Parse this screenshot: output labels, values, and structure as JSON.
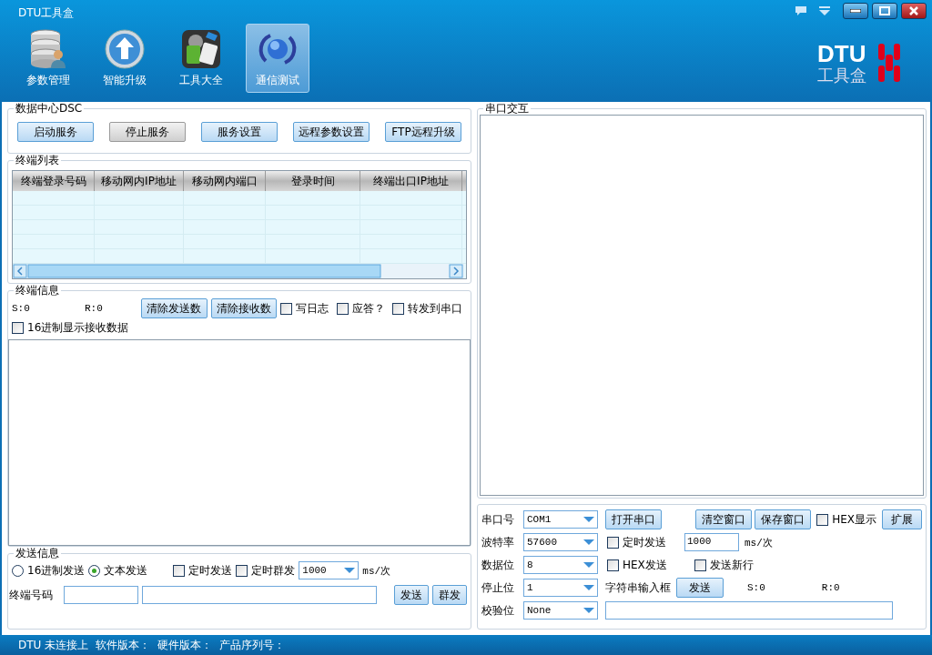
{
  "window": {
    "title": "DTU工具盒"
  },
  "toolbar": [
    {
      "label": "参数管理",
      "kind": "database",
      "selected": false
    },
    {
      "label": "智能升级",
      "kind": "upgrade",
      "selected": false
    },
    {
      "label": "工具大全",
      "kind": "tools",
      "selected": false
    },
    {
      "label": "通信测试",
      "kind": "globe",
      "selected": true
    }
  ],
  "logo": {
    "line_1": "DTU",
    "line_2": "工具盒"
  },
  "data_center": {
    "title": "数据中心DSC",
    "buttons": [
      "启动服务",
      "停止服务",
      "服务设置",
      "远程参数设置",
      "FTP远程升级"
    ]
  },
  "terminal_list": {
    "title": "终端列表",
    "columns": [
      "终端登录号码",
      "移动网内IP地址",
      "移动网内端口",
      "登录时间",
      "终端出口IP地址"
    ]
  },
  "terminal_info": {
    "title": "终端信息",
    "sent": "S:0",
    "received": "R:0",
    "buttons": [
      "清除发送数",
      "清除接收数"
    ],
    "options": [
      {
        "label": "写日志",
        "checked": false
      },
      {
        "label": "应答？",
        "checked": false
      },
      {
        "label": "转发到串口",
        "checked": false
      }
    ],
    "hex_receive": {
      "label": "16进制显示接收数据",
      "checked": false
    }
  },
  "send_info": {
    "title": "发送信息",
    "modes": [
      {
        "label": "16进制发送",
        "selected": false
      },
      {
        "label": "文本发送",
        "selected": true
      }
    ],
    "options": [
      {
        "label": "定时发送",
        "checked": false
      },
      {
        "label": "定时群发",
        "checked": false
      }
    ],
    "interval": "1000",
    "interval_unit": "ms/次",
    "terminal_label": "终端号码",
    "buttons": [
      "发送",
      "群发"
    ]
  },
  "serial": {
    "title": "串口交互",
    "fields": [
      {
        "label": "串口号",
        "value": "COM1"
      },
      {
        "label": "波特率",
        "value": "57600"
      },
      {
        "label": "数据位",
        "value": "8"
      },
      {
        "label": "停止位",
        "value": "1"
      },
      {
        "label": "校验位",
        "value": "None"
      }
    ],
    "open_button": "打开串口",
    "clear_button": "清空窗口",
    "save_button": "保存窗口",
    "hex_display": {
      "label": "HEX显示",
      "checked": false
    },
    "expand_button": "扩展",
    "timed_send": {
      "label": "定时发送",
      "checked": false
    },
    "interval": "1000",
    "interval_unit": "ms/次",
    "hex_send": {
      "label": "HEX发送",
      "checked": false
    },
    "send_newline": {
      "label": "发送新行",
      "checked": false
    },
    "input_label": "字符串输入框",
    "send_button": "发送",
    "sent": "S:0",
    "received": "R:0"
  },
  "status_bar": [
    "DTU 未连接上",
    "软件版本：",
    "硬件版本：",
    "产品序列号："
  ]
}
